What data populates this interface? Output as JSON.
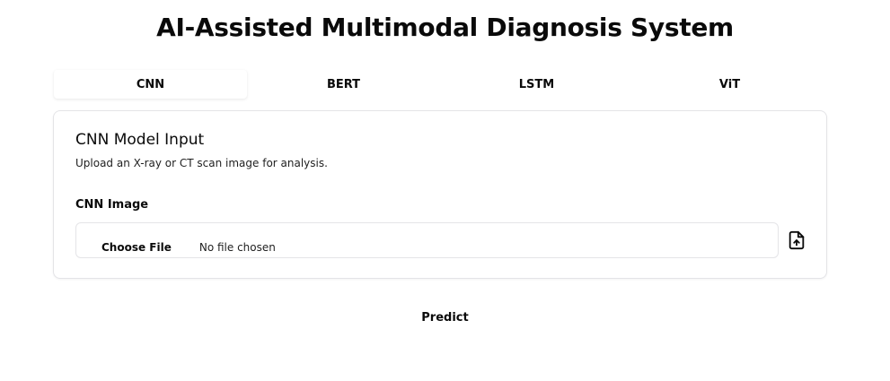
{
  "app": {
    "title": "AI-Assisted Multimodal Diagnosis System"
  },
  "tabs": [
    {
      "label": "CNN",
      "active": true
    },
    {
      "label": "BERT",
      "active": false
    },
    {
      "label": "LSTM",
      "active": false
    },
    {
      "label": "ViT",
      "active": false
    }
  ],
  "card": {
    "title": "CNN Model Input",
    "description": "Upload an X-ray or CT scan image for analysis.",
    "field_label": "CNN Image",
    "choose_file_label": "Choose File",
    "file_status": "No file chosen",
    "upload_icon": "file-upload-icon"
  },
  "actions": {
    "predict_label": "Predict"
  }
}
